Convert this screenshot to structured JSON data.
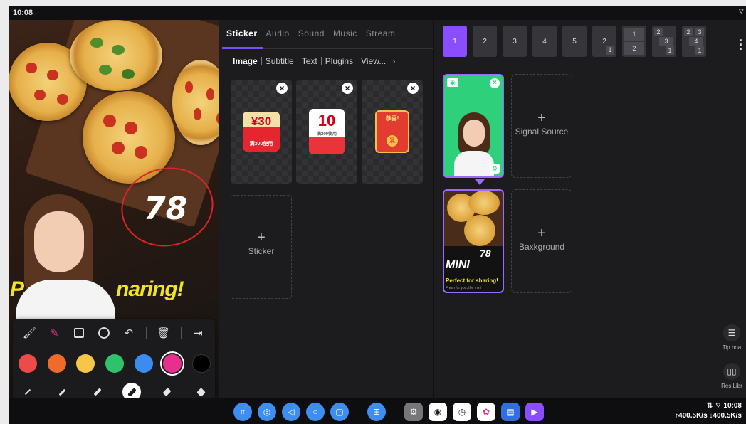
{
  "status_bar": {
    "time": "10:08"
  },
  "preview": {
    "annotation_number": "78",
    "banner_text_left": "P",
    "banner_text_right": "naring!",
    "colors": [
      "#ee4a4a",
      "#f06a2c",
      "#f7c548",
      "#2fc16b",
      "#3b8cf0",
      "#e6308c",
      "#000000"
    ],
    "selected_color_index": 5,
    "selected_size_index": 3
  },
  "sticker_panel": {
    "tabs": [
      "Sticker",
      "Audio",
      "Sound",
      "Music",
      "Stream"
    ],
    "active_tab": "Sticker",
    "subtabs": [
      "Image",
      "Subtitle",
      "Text",
      "Plugins",
      "View..."
    ],
    "subtab_chevron": "›",
    "stickers": [
      {
        "value": "¥30",
        "sub": "满300使用"
      },
      {
        "value": "10",
        "sub": "满200使用"
      },
      {
        "value": "恭喜!",
        "sub": "发"
      }
    ],
    "close_glyph": "×",
    "add_label": "Sticker",
    "add_glyph": "+"
  },
  "layout_bar": {
    "buttons": [
      "1",
      "2",
      "3",
      "4",
      "5"
    ]
  },
  "sources": {
    "signal_label": "Signal Source",
    "background_label": "Baxkground",
    "add_glyph": "+",
    "preview_number": "78",
    "preview_title": "MINI",
    "preview_tagline": "Perfect for sharing!",
    "preview_small": "Fresh for you, the mini"
  },
  "side": {
    "tip_label": "Tip boa",
    "res_label": "Res Libr"
  },
  "dock": {
    "apps": [
      "camera-scan",
      "record",
      "back",
      "home",
      "recents",
      "apps",
      "settings",
      "store",
      "clock",
      "gallery",
      "notes",
      "player"
    ],
    "net_time": "10:08",
    "net_speed": "↑400.5K/s ↓400.5K/s"
  }
}
